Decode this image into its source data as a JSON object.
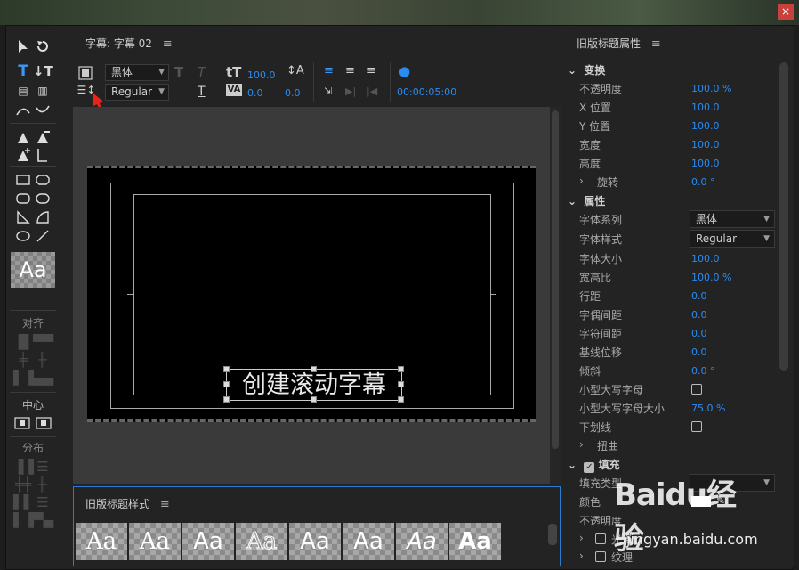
{
  "window": {
    "close_glyph": "×"
  },
  "tools": {
    "align_label": "对齐",
    "center_label": "中心",
    "distribute_label": "分布",
    "style_preview": "Aa"
  },
  "center": {
    "title": "字幕: 字幕 02",
    "toolbar": {
      "font_family": "黑体",
      "font_style": "Regular",
      "font_size": "100.0",
      "kerning": "0.0",
      "leading": "0.0",
      "timecode": "00:00:05:00"
    },
    "caption_text": "创建滚动字幕"
  },
  "styles_panel": {
    "title": "旧版标题样式",
    "swatches": [
      "Aa",
      "Aa",
      "Aa",
      "Aa",
      "Aa",
      "Aa",
      "Aa",
      "Aa"
    ]
  },
  "properties": {
    "title": "旧版标题属性",
    "transform": {
      "header": "变换",
      "opacity_label": "不透明度",
      "opacity": "100.0 %",
      "x_label": "X 位置",
      "x": "100.0",
      "y_label": "Y 位置",
      "y": "100.0",
      "width_label": "宽度",
      "width": "100.0",
      "height_label": "高度",
      "height": "100.0",
      "rotation_label": "旋转",
      "rotation": "0.0 °"
    },
    "props": {
      "header": "属性",
      "font_family_label": "字体系列",
      "font_family": "黑体",
      "font_style_label": "字体样式",
      "font_style": "Regular",
      "font_size_label": "字体大小",
      "font_size": "100.0",
      "aspect_label": "宽高比",
      "aspect": "100.0 %",
      "leading_label": "行距",
      "leading": "0.0",
      "kerning_label": "字偶间距",
      "kerning": "0.0",
      "tracking_label": "字符间距",
      "tracking": "0.0",
      "baseline_label": "基线位移",
      "baseline": "0.0",
      "slant_label": "倾斜",
      "slant": "0.0 °",
      "smallcaps_label": "小型大写字母",
      "smallcaps_size_label": "小型大写字母大小",
      "smallcaps_size": "75.0 %",
      "underline_label": "下划线",
      "distort_label": "扭曲"
    },
    "fill": {
      "header": "填充",
      "type_label": "填充类型",
      "color_label": "颜色",
      "opacity_label": "不透明度",
      "sheen_label": "光泽",
      "texture_label": "纹理"
    }
  },
  "watermark": {
    "brand": "Baidu经验",
    "url": "jingyan.baidu.com"
  }
}
